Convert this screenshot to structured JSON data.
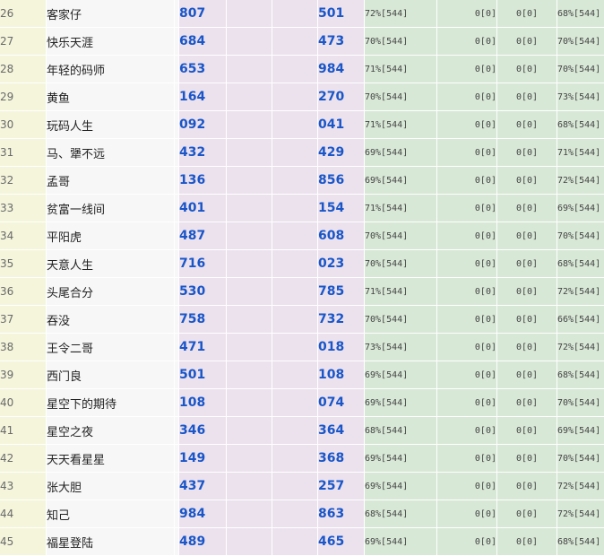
{
  "rows": [
    {
      "idx": "26",
      "name": "客家仔",
      "n1": "807",
      "n2": "501",
      "p1": "72%[544]",
      "p2": "0[0]",
      "p3": "0[0]",
      "p4": "68%[544]"
    },
    {
      "idx": "27",
      "name": "快乐天涯",
      "n1": "684",
      "n2": "473",
      "p1": "70%[544]",
      "p2": "0[0]",
      "p3": "0[0]",
      "p4": "70%[544]"
    },
    {
      "idx": "28",
      "name": "年轻的码师",
      "n1": "653",
      "n2": "984",
      "p1": "71%[544]",
      "p2": "0[0]",
      "p3": "0[0]",
      "p4": "70%[544]"
    },
    {
      "idx": "29",
      "name": "黄鱼",
      "n1": "164",
      "n2": "270",
      "p1": "70%[544]",
      "p2": "0[0]",
      "p3": "0[0]",
      "p4": "73%[544]"
    },
    {
      "idx": "30",
      "name": "玩码人生",
      "n1": "092",
      "n2": "041",
      "p1": "71%[544]",
      "p2": "0[0]",
      "p3": "0[0]",
      "p4": "68%[544]"
    },
    {
      "idx": "31",
      "name": "马、犟不远",
      "n1": "432",
      "n2": "429",
      "p1": "69%[544]",
      "p2": "0[0]",
      "p3": "0[0]",
      "p4": "71%[544]"
    },
    {
      "idx": "32",
      "name": "孟哥",
      "n1": "136",
      "n2": "856",
      "p1": "69%[544]",
      "p2": "0[0]",
      "p3": "0[0]",
      "p4": "72%[544]"
    },
    {
      "idx": "33",
      "name": "贫富一线间",
      "n1": "401",
      "n2": "154",
      "p1": "71%[544]",
      "p2": "0[0]",
      "p3": "0[0]",
      "p4": "69%[544]"
    },
    {
      "idx": "34",
      "name": "平阳虎",
      "n1": "487",
      "n2": "608",
      "p1": "70%[544]",
      "p2": "0[0]",
      "p3": "0[0]",
      "p4": "70%[544]"
    },
    {
      "idx": "35",
      "name": "天意人生",
      "n1": "716",
      "n2": "023",
      "p1": "70%[544]",
      "p2": "0[0]",
      "p3": "0[0]",
      "p4": "68%[544]"
    },
    {
      "idx": "36",
      "name": "头尾合分",
      "n1": "530",
      "n2": "785",
      "p1": "71%[544]",
      "p2": "0[0]",
      "p3": "0[0]",
      "p4": "72%[544]"
    },
    {
      "idx": "37",
      "name": "吞没",
      "n1": "758",
      "n2": "732",
      "p1": "70%[544]",
      "p2": "0[0]",
      "p3": "0[0]",
      "p4": "66%[544]"
    },
    {
      "idx": "38",
      "name": "王令二哥",
      "n1": "471",
      "n2": "018",
      "p1": "73%[544]",
      "p2": "0[0]",
      "p3": "0[0]",
      "p4": "72%[544]"
    },
    {
      "idx": "39",
      "name": "西门良",
      "n1": "501",
      "n2": "108",
      "p1": "69%[544]",
      "p2": "0[0]",
      "p3": "0[0]",
      "p4": "68%[544]"
    },
    {
      "idx": "40",
      "name": "星空下的期待",
      "n1": "108",
      "n2": "074",
      "p1": "69%[544]",
      "p2": "0[0]",
      "p3": "0[0]",
      "p4": "70%[544]"
    },
    {
      "idx": "41",
      "name": "星空之夜",
      "n1": "346",
      "n2": "364",
      "p1": "68%[544]",
      "p2": "0[0]",
      "p3": "0[0]",
      "p4": "69%[544]"
    },
    {
      "idx": "42",
      "name": "天天看星星",
      "n1": "149",
      "n2": "368",
      "p1": "69%[544]",
      "p2": "0[0]",
      "p3": "0[0]",
      "p4": "70%[544]"
    },
    {
      "idx": "43",
      "name": "张大胆",
      "n1": "437",
      "n2": "257",
      "p1": "69%[544]",
      "p2": "0[0]",
      "p3": "0[0]",
      "p4": "72%[544]"
    },
    {
      "idx": "44",
      "name": "知己",
      "n1": "984",
      "n2": "863",
      "p1": "68%[544]",
      "p2": "0[0]",
      "p3": "0[0]",
      "p4": "72%[544]"
    },
    {
      "idx": "45",
      "name": "福星登陆",
      "n1": "489",
      "n2": "465",
      "p1": "69%[544]",
      "p2": "0[0]",
      "p3": "0[0]",
      "p4": "68%[544]"
    }
  ]
}
